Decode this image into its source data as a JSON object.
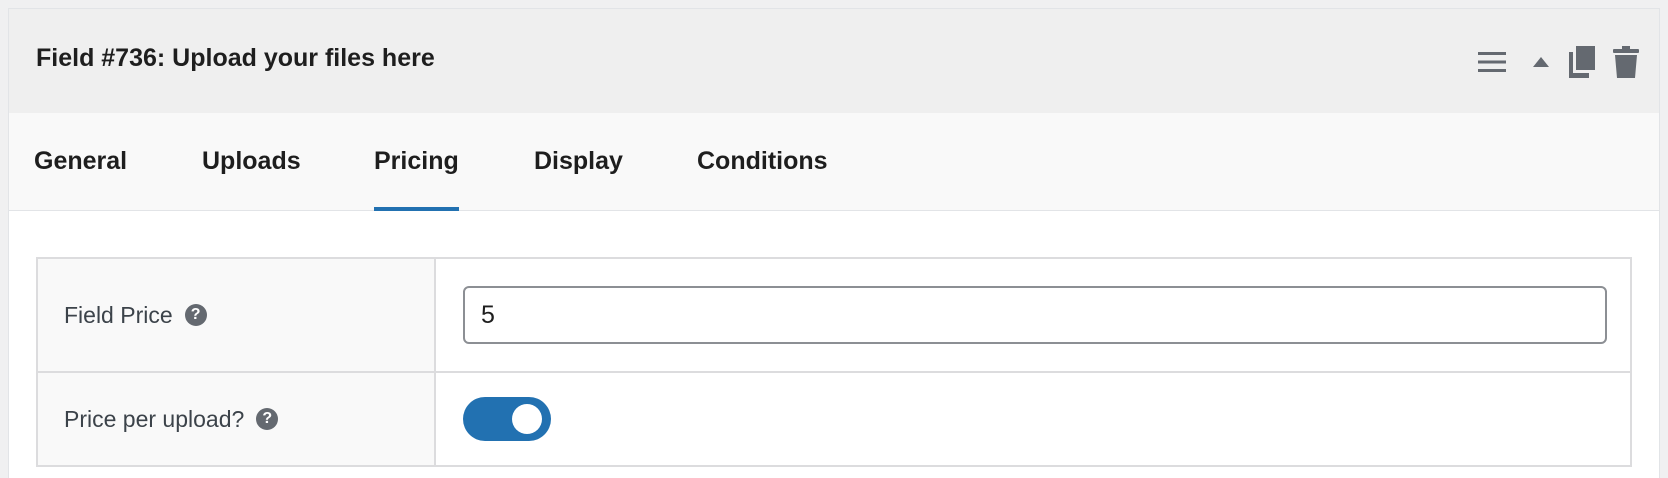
{
  "panel": {
    "title": "Field #736: Upload your files here"
  },
  "header_actions": [
    {
      "icon": "menu-icon",
      "label": "Reorder"
    },
    {
      "icon": "collapse-arrow-icon",
      "label": "Collapse"
    },
    {
      "icon": "duplicate-icon",
      "label": "Duplicate"
    },
    {
      "icon": "trash-icon",
      "label": "Delete"
    }
  ],
  "tabs": [
    {
      "label": "General",
      "active": false
    },
    {
      "label": "Uploads",
      "active": false
    },
    {
      "label": "Pricing",
      "active": true
    },
    {
      "label": "Display",
      "active": false
    },
    {
      "label": "Conditions",
      "active": false
    }
  ],
  "settings": {
    "field_price": {
      "label": "Field Price",
      "help": "?",
      "value": "5"
    },
    "price_per_upload": {
      "label": "Price per upload?",
      "help": "?",
      "enabled": true
    }
  },
  "colors": {
    "accent": "#2271b1",
    "header_bg": "#efefef",
    "tabs_bg": "#f9f9f9",
    "icon": "#646970"
  }
}
